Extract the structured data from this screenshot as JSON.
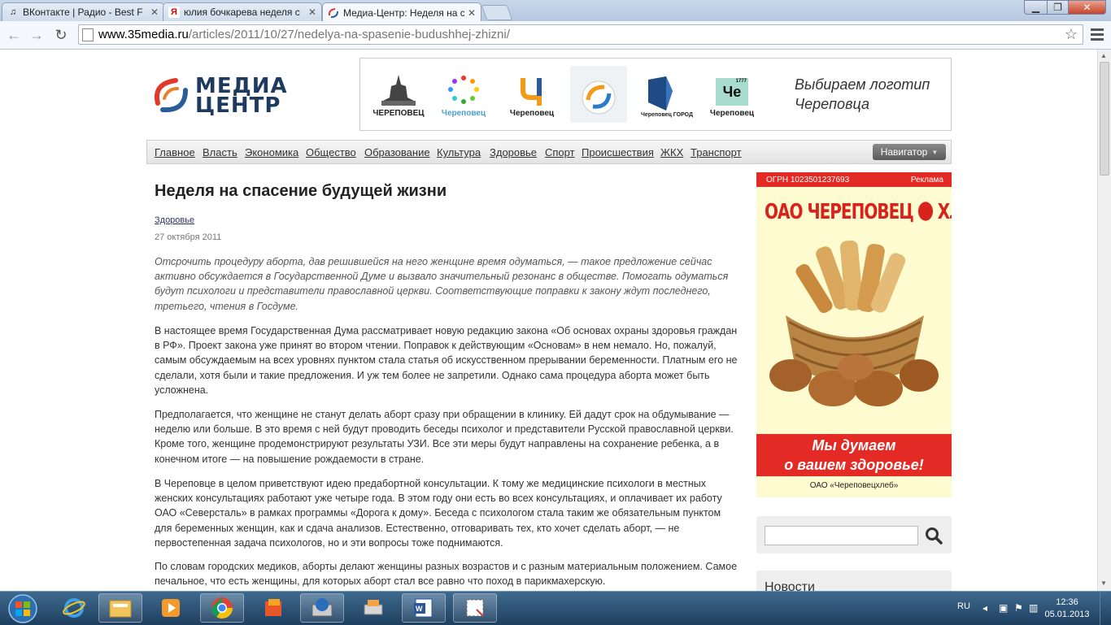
{
  "browser": {
    "tabs": [
      {
        "title": "ВКонтакте | Радио - Best F",
        "icon": "music-note-icon"
      },
      {
        "title": "юлия бочкарева неделя с",
        "icon": "yandex-icon"
      },
      {
        "title": "Медиа-Центр: Неделя на с",
        "icon": "media-center-icon"
      }
    ],
    "close_glyph": "✕",
    "url_host": "www.35media.ru",
    "url_path": "/articles/2011/10/27/nedelya-na-spasenie-budushhej-zhizni/"
  },
  "site": {
    "logo_line1": "МЕДИА",
    "logo_line2": "ЦЕНТР",
    "banner": {
      "logo_labels": [
        "ЧЕРЕПОВЕЦ",
        "Череповец",
        "Череповец",
        "",
        "Череповец ГОРОД",
        "Череповец"
      ],
      "che_mark": "Че",
      "che_year": "1777",
      "text_line1": "Выбираем логотип",
      "text_line2": "Череповца"
    },
    "nav": [
      "Главное",
      "Власть",
      "Экономика",
      "Общество",
      "Образование",
      "Культура",
      "Здоровье",
      "Спорт",
      "Происшествия",
      "ЖКХ",
      "Транспорт"
    ],
    "navigator_label": "Навигатор"
  },
  "article": {
    "title": "Неделя на спасение будущей жизни",
    "category": "Здоровье",
    "date": "27 октября 2011",
    "lead": "Отсрочить процедуру аборта, дав решившейся на него женщине время одуматься, — такое предложение сейчас активно обсуждается в Государственной Думе и вызвало значительный резонанс в обществе. Помогать одуматься будут психологи и представители православной церкви. Соответствующие поправки к закону ждут последнего, третьего, чтения в Госдуме.",
    "paragraphs": [
      "В настоящее время Государственная Дума рассматривает новую редакцию закона «Об основах охраны здоровья граждан в РФ». Проект закона уже принят во втором чтении. Поправок к действующим «Основам» в нем немало. Но, пожалуй, самым обсуждаемым на всех уровнях пунктом стала статья об искусственном прерывании беременности. Платным его не сделали, хотя были и такие предложения. И уж тем более не запретили. Однако сама процедура аборта может быть усложнена.",
      "Предполагается, что женщине не станут делать аборт сразу при обращении в клинику. Ей дадут срок на обдумывание — неделю или больше. В это время с ней будут проводить беседы психолог и представители Русской православной церкви. Кроме того, женщине продемонстрируют результаты УЗИ. Все эти меры будут направлены на сохранение ребенка, а в конечном итоге — на повышение рождаемости в стране.",
      "В Череповце в целом приветствуют идею предабортной консультации. К тому же медицинские психологи в местных женских консультациях работают уже четыре года. В этом году они есть во всех консультациях, и оплачивает их работу ОАО «Северсталь» в рамках программы «Дорога к дому». Беседа с психологом стала таким же обязательным пунктом для беременных женщин, как и сдача анализов. Естественно, отговаривать тех, кто хочет сделать аборт, — не первостепенная задача психологов, но и эти вопросы тоже поднимаются.",
      "По словам городских медиков, аборты делают женщины разных возрастов и с разным материальным положением. Самое печальное, что есть женщины, для которых аборт стал все равно что поход в парикмахерскую."
    ]
  },
  "sidebar": {
    "ad": {
      "ogrn": "ОГРН 1023501237693",
      "label": "Реклама",
      "brand": "ОАО ЧЕРЕПОВЕЦ",
      "brand_tail": "ХЛЕБ",
      "slogan_line1": "Мы думаем",
      "slogan_line2": "о вашем здоровье!",
      "company": "ОАО «Череповецхлеб»"
    },
    "search_value": "",
    "news_title": "Новости"
  },
  "taskbar": {
    "lang": "RU",
    "time": "12:36",
    "date": "05.01.2013"
  }
}
